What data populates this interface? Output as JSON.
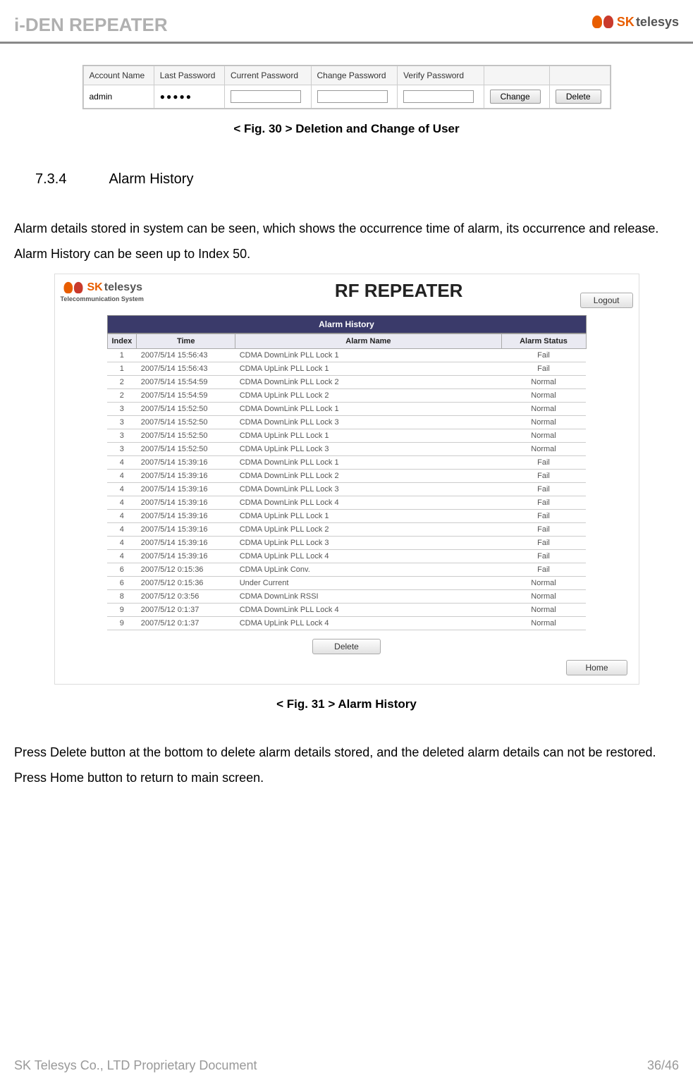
{
  "header": {
    "title": "i-DEN REPEATER",
    "logo_sk": "SK",
    "logo_telesys": "telesys"
  },
  "user_table": {
    "headers": [
      "Account Name",
      "Last Password",
      "Current Password",
      "Change Password",
      "Verify Password"
    ],
    "row": {
      "account": "admin",
      "last_pw": "●●●●●"
    },
    "change_btn": "Change",
    "delete_btn": "Delete"
  },
  "fig30_caption": "< Fig. 30 > Deletion and Change of User",
  "section": {
    "num": "7.3.4",
    "title": "Alarm History"
  },
  "para1": "Alarm details stored in system can be seen, which shows the occurrence time of alarm, its occurrence and release.",
  "para2": "Alarm History can be seen up to Index 50.",
  "alarm_shot": {
    "logo_sk": "SK",
    "logo_telesys": "telesys",
    "logo_sub": "Telecommunication System",
    "title": "RF REPEATER",
    "logout_btn": "Logout",
    "table_title": "Alarm History",
    "columns": [
      "Index",
      "Time",
      "Alarm Name",
      "Alarm Status"
    ],
    "rows": [
      {
        "idx": "1",
        "time": "2007/5/14 15:56:43",
        "name": "CDMA DownLink PLL Lock 1",
        "status": "Fail",
        "cls": "fail"
      },
      {
        "idx": "1",
        "time": "2007/5/14 15:56:43",
        "name": "CDMA UpLink PLL Lock 1",
        "status": "Fail",
        "cls": "fail"
      },
      {
        "idx": "2",
        "time": "2007/5/14 15:54:59",
        "name": "CDMA DownLink PLL Lock 2",
        "status": "Normal",
        "cls": "normal"
      },
      {
        "idx": "2",
        "time": "2007/5/14 15:54:59",
        "name": "CDMA UpLink PLL Lock 2",
        "status": "Normal",
        "cls": "normal"
      },
      {
        "idx": "3",
        "time": "2007/5/14 15:52:50",
        "name": "CDMA DownLink PLL Lock 1",
        "status": "Normal",
        "cls": "normal"
      },
      {
        "idx": "3",
        "time": "2007/5/14 15:52:50",
        "name": "CDMA DownLink PLL Lock 3",
        "status": "Normal",
        "cls": "normal"
      },
      {
        "idx": "3",
        "time": "2007/5/14 15:52:50",
        "name": "CDMA UpLink PLL Lock 1",
        "status": "Normal",
        "cls": "normal"
      },
      {
        "idx": "3",
        "time": "2007/5/14 15:52:50",
        "name": "CDMA UpLink PLL Lock 3",
        "status": "Normal",
        "cls": "normal"
      },
      {
        "idx": "4",
        "time": "2007/5/14 15:39:16",
        "name": "CDMA DownLink PLL Lock 1",
        "status": "Fail",
        "cls": "fail"
      },
      {
        "idx": "4",
        "time": "2007/5/14 15:39:16",
        "name": "CDMA DownLink PLL Lock 2",
        "status": "Fail",
        "cls": "fail"
      },
      {
        "idx": "4",
        "time": "2007/5/14 15:39:16",
        "name": "CDMA DownLink PLL Lock 3",
        "status": "Fail",
        "cls": "fail"
      },
      {
        "idx": "4",
        "time": "2007/5/14 15:39:16",
        "name": "CDMA DownLink PLL Lock 4",
        "status": "Fail",
        "cls": "fail"
      },
      {
        "idx": "4",
        "time": "2007/5/14 15:39:16",
        "name": "CDMA UpLink PLL Lock 1",
        "status": "Fail",
        "cls": "fail"
      },
      {
        "idx": "4",
        "time": "2007/5/14 15:39:16",
        "name": "CDMA UpLink PLL Lock 2",
        "status": "Fail",
        "cls": "fail"
      },
      {
        "idx": "4",
        "time": "2007/5/14 15:39:16",
        "name": "CDMA UpLink PLL Lock 3",
        "status": "Fail",
        "cls": "fail"
      },
      {
        "idx": "4",
        "time": "2007/5/14 15:39:16",
        "name": "CDMA UpLink PLL Lock 4",
        "status": "Fail",
        "cls": "fail"
      },
      {
        "idx": "6",
        "time": "2007/5/12 0:15:36",
        "name": "CDMA UpLink Conv.",
        "status": "Fail",
        "cls": "fail"
      },
      {
        "idx": "6",
        "time": "2007/5/12 0:15:36",
        "name": "Under Current",
        "status": "Normal",
        "cls": "normal"
      },
      {
        "idx": "8",
        "time": "2007/5/12 0:3:56",
        "name": "CDMA DownLink RSSI",
        "status": "Normal",
        "cls": "normal"
      },
      {
        "idx": "9",
        "time": "2007/5/12 0:1:37",
        "name": "CDMA DownLink PLL Lock 4",
        "status": "Normal",
        "cls": "normal"
      },
      {
        "idx": "9",
        "time": "2007/5/12 0:1:37",
        "name": "CDMA UpLink PLL Lock 4",
        "status": "Normal",
        "cls": "normal"
      }
    ],
    "delete_btn": "Delete",
    "home_btn": "Home"
  },
  "fig31_caption": "< Fig. 31 > Alarm History",
  "para3": "Press Delete button at the bottom to delete alarm details stored, and the deleted alarm details can not be restored.",
  "para4": "Press Home button to return to main screen.",
  "footer": {
    "left": "SK Telesys Co., LTD Proprietary Document",
    "right": "36/46"
  }
}
